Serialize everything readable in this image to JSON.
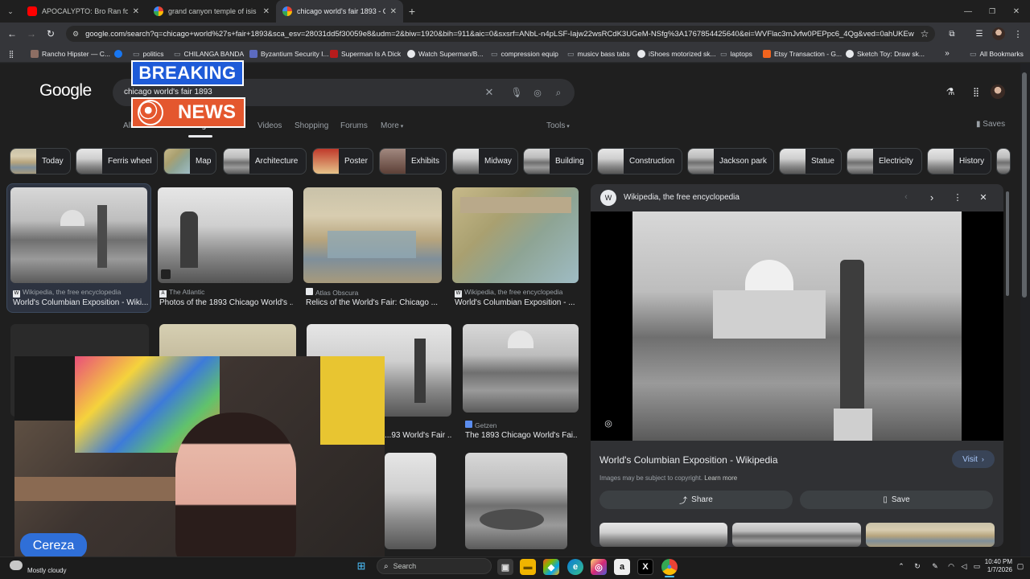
{
  "tabs": [
    {
      "title": "APOCALYPTO: Bro Ran for His L",
      "favicon_color": "#ff0000"
    },
    {
      "title": "grand canyon temple of isis - G",
      "favicon_color": "#4285f4"
    },
    {
      "title": "chicago world's fair 1893 - Goo",
      "favicon_color": "#4285f4"
    }
  ],
  "address_bar": {
    "url": "google.com/search?q=chicago+world%27s+fair+1893&sca_esv=28031dd5f30059e8&udm=2&biw=1920&bih=911&aic=0&sxsrf=ANbL-n4pLSF-Iajw22wsRCdK3UGeM-NSfg%3A1767854425640&ei=WVFlac3mJvfw0PEPpc6_4Qg&ved=0ahUKEwiN97..."
  },
  "bookmarks": [
    {
      "label": "Rancho Hipster — C...",
      "color": "#8d6e63"
    },
    {
      "label": "",
      "color": "#1877f2"
    },
    {
      "label": "politics",
      "color": "#9aa0a6"
    },
    {
      "label": "CHILANGA BANDA",
      "color": "#9aa0a6"
    },
    {
      "label": "Byzantium Security I...",
      "color": "#5c6bc0"
    },
    {
      "label": "Superman Is A Dick",
      "color": "#b71c1c"
    },
    {
      "label": "Watch Superman/B...",
      "color": "#e8eaed"
    },
    {
      "label": "compression equip",
      "color": "#9aa0a6"
    },
    {
      "label": "musicv bass tabs",
      "color": "#9aa0a6"
    },
    {
      "label": "iShoes motorized sk...",
      "color": "#e8eaed"
    },
    {
      "label": "laptops",
      "color": "#9aa0a6"
    },
    {
      "label": "Etsy Transaction - G...",
      "color": "#f1641e"
    },
    {
      "label": "Sketch Toy: Draw sk...",
      "color": "#e8eaed"
    }
  ],
  "all_bookmarks_label": "All Bookmarks",
  "google": {
    "logo": "Google",
    "query": "chicago world's fair 1893",
    "nav_tabs": [
      "All",
      "Images",
      "Videos",
      "Shopping",
      "Forums",
      "More"
    ],
    "tools_label": "Tools",
    "saves_label": "Saves"
  },
  "overlay": {
    "breaking": "BREAKING",
    "news": "NEWS",
    "streamer": "Cereza"
  },
  "chips": [
    "Today",
    "Ferris wheel",
    "Map",
    "Architecture",
    "Poster",
    "Exhibits",
    "Midway",
    "Building",
    "Construction",
    "Jackson park",
    "Statue",
    "Electricity",
    "History"
  ],
  "results": [
    {
      "source": "Wikipedia, the free encyclopedia",
      "title": "World's Columbian Exposition - Wiki..."
    },
    {
      "source": "The Atlantic",
      "title": "Photos of the 1893 Chicago World's ..."
    },
    {
      "source": "Atlas Obscura",
      "title": "Relics of the World's Fair: Chicago ..."
    },
    {
      "source": "Wikipedia, the free encyclopedia",
      "title": "World's Columbian Exposition - ..."
    },
    {
      "source": "",
      "title": "...93 World's Fair ..."
    },
    {
      "source": "Getzen",
      "title": "The 1893 Chicago World's Fai..."
    }
  ],
  "panel": {
    "source": "Wikipedia, the free encyclopedia",
    "title": "World's Columbian Exposition - Wikipedia",
    "visit_label": "Visit",
    "copyright": "Images may be subject to copyright.",
    "learn_more": "Learn more",
    "share_label": "Share",
    "save_label": "Save"
  },
  "taskbar": {
    "weather": "Mostly cloudy",
    "search_placeholder": "Search",
    "time": "10:40 PM",
    "date": "1/7/2026"
  }
}
